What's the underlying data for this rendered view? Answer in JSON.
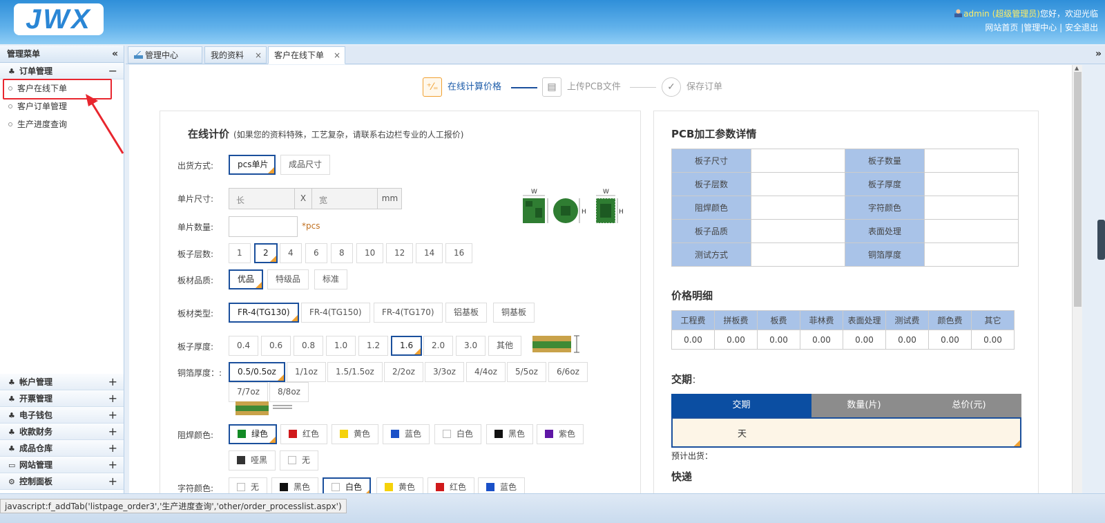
{
  "header": {
    "logo": "JWX",
    "user": "admin",
    "role": "超级管理员",
    "greeting": "您好，欢迎光临",
    "links": [
      "网站首页",
      "|管理中心",
      "|",
      "安全退出"
    ]
  },
  "sidebar": {
    "title": "管理菜单",
    "collapse": "«",
    "sections_top": {
      "title": "订单管理",
      "toggle": "−",
      "items": [
        "客户在线下单",
        "客户订单管理",
        "生产进度查询"
      ]
    },
    "sections_bottom": [
      {
        "title": "帐户管理",
        "icon": "leaf-icon"
      },
      {
        "title": "开票管理",
        "icon": "leaf-icon"
      },
      {
        "title": "电子钱包",
        "icon": "leaf-icon"
      },
      {
        "title": "收款财务",
        "icon": "leaf-icon"
      },
      {
        "title": "成品仓库",
        "icon": "leaf-icon"
      },
      {
        "title": "网站管理",
        "icon": "monitor-icon"
      },
      {
        "title": "控制面板",
        "icon": "gear-icon"
      }
    ],
    "plus": "+"
  },
  "tabs": [
    {
      "label": "管理中心",
      "icon": "home-icon"
    },
    {
      "label": "我的资料"
    },
    {
      "label": "客户在线下单"
    }
  ],
  "tab_close": "×",
  "tab_dropdown": "»",
  "steps": [
    {
      "label": "在线计算价格",
      "icon": "calculator-icon"
    },
    {
      "label": "上传PCB文件",
      "icon": "document-icon"
    },
    {
      "label": "保存订单",
      "icon": "check-icon"
    }
  ],
  "form": {
    "title": "在线计价",
    "note": "(如果您的资料特殊，工艺复杂，请联系右边栏专业的人工报价)",
    "ship": {
      "label": "出货方式:",
      "options": [
        "pcs单片",
        "成品尺寸"
      ]
    },
    "size": {
      "label": "单片尺寸:",
      "len": "长",
      "x": "X",
      "wid": "宽",
      "unit": "mm"
    },
    "qty": {
      "label": "单片数量:",
      "unit": "*pcs"
    },
    "layers": {
      "label": "板子层数:",
      "options": [
        "1",
        "2",
        "4",
        "6",
        "8",
        "10",
        "12",
        "14",
        "16"
      ]
    },
    "quality": {
      "label": "板材品质:",
      "options": [
        "优品",
        "特级品",
        "标准"
      ]
    },
    "material": {
      "label": "板材类型:",
      "options": [
        "FR-4(TG130)",
        "FR-4(TG150)",
        "FR-4(TG170)",
        "铝基板",
        "铜基板"
      ]
    },
    "thickness": {
      "label": "板子厚度:",
      "options": [
        "0.4",
        "0.6",
        "0.8",
        "1.0",
        "1.2",
        "1.6",
        "2.0",
        "3.0",
        "其他"
      ]
    },
    "copper": {
      "label": "铜箔厚度：:",
      "options": [
        "0.5/0.5oz",
        "1/1oz",
        "1.5/1.5oz",
        "2/2oz",
        "3/3oz",
        "4/4oz",
        "5/5oz",
        "6/6oz",
        "7/7oz",
        "8/8oz"
      ]
    },
    "mask": {
      "label": "阻焊颜色:",
      "options": [
        "绿色",
        "红色",
        "黄色",
        "蓝色",
        "白色",
        "黑色",
        "紫色",
        "哑黑",
        "无"
      ]
    },
    "silk": {
      "label": "字符颜色:",
      "options": [
        "无",
        "黑色",
        "白色",
        "黄色",
        "红色",
        "蓝色"
      ]
    },
    "img_labels": {
      "w": "W",
      "h": "H"
    }
  },
  "colors": {
    "green": "#128a25",
    "red": "#d0191b",
    "yellow": "#f5d20a",
    "blue": "#1a50c8",
    "white": "#ffffff",
    "black": "#111111",
    "purple": "#5f17a5",
    "matteblack": "#333333",
    "accent": "#1a4f9c",
    "orange": "#f0a030"
  },
  "right": {
    "params_title": "PCB加工参数详情",
    "params": [
      [
        "板子尺寸",
        "",
        "板子数量",
        ""
      ],
      [
        "板子层数",
        "",
        "板子厚度",
        ""
      ],
      [
        "阻焊颜色",
        "",
        "字符颜色",
        ""
      ],
      [
        "板子品质",
        "",
        "表面处理",
        ""
      ],
      [
        "测试方式",
        "",
        "铜箔厚度",
        ""
      ]
    ],
    "price_title": "价格明细",
    "price_heads": [
      "工程费",
      "拼板费",
      "板费",
      "菲林费",
      "表面处理",
      "测试费",
      "颜色费",
      "其它"
    ],
    "price_vals": [
      "0.00",
      "0.00",
      "0.00",
      "0.00",
      "0.00",
      "0.00",
      "0.00",
      "0.00"
    ],
    "delivery_title": "交期",
    "delivery_colon": "：",
    "delivery_heads": [
      "交期",
      "数量(片)",
      "总价(元)"
    ],
    "delivery_day": "天",
    "eta": "预计出货：",
    "express": "快递"
  },
  "status": "javascript:f_addTab('listpage_order3','生产进度查询','other/order_processlist.aspx')"
}
